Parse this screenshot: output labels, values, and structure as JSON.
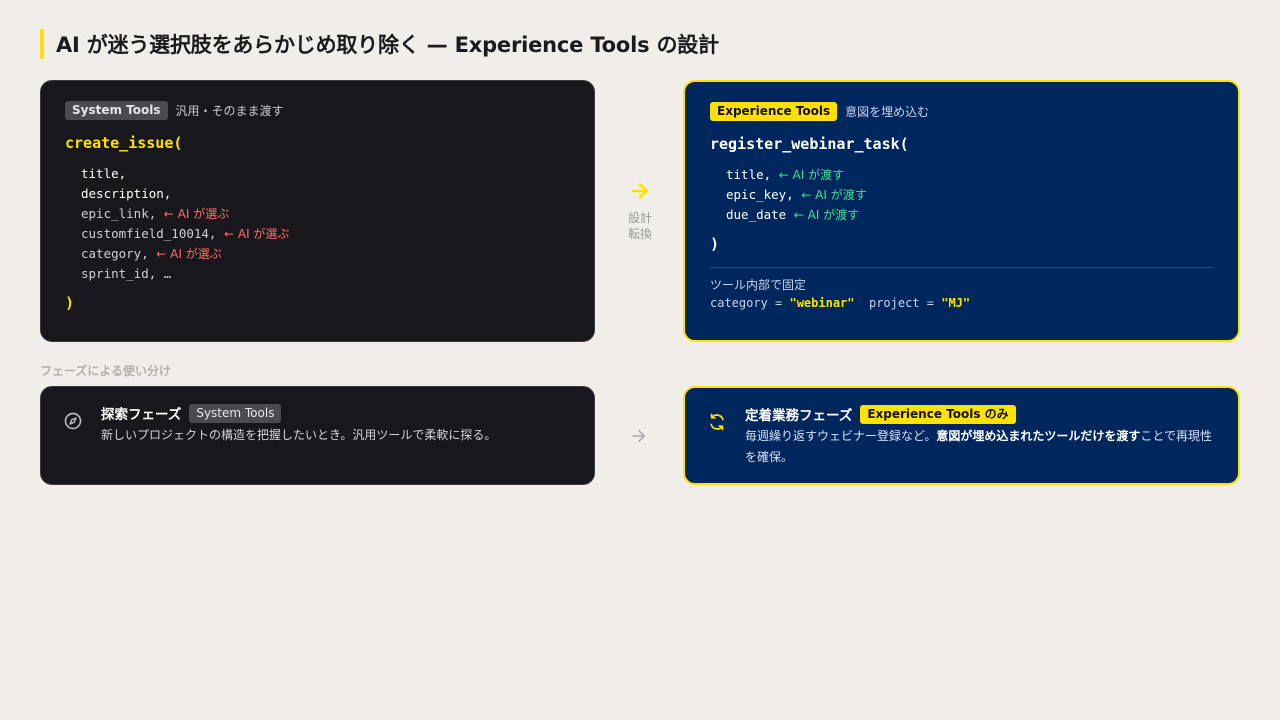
{
  "title": "AI が迷う選択肢をあらかじめ取り除く — Experience Tools の設計",
  "colors": {
    "accent": "#ffe100",
    "navy": "#00265e",
    "dark": "#18181c",
    "red": "#ff6b6b",
    "green": "#3fe08f",
    "yellow_string": "#ffe100"
  },
  "system_card": {
    "badge": "System Tools",
    "subtitle": "汎用・そのまま渡す",
    "function": "create_issue(",
    "close": ")",
    "params": [
      {
        "name": "title,",
        "note": ""
      },
      {
        "name": "description,",
        "note": ""
      },
      {
        "name": "epic_link,",
        "note": "← AI が選ぶ"
      },
      {
        "name": "customfield_10014,",
        "note": "← AI が選ぶ"
      },
      {
        "name": "category,",
        "note": "← AI が選ぶ"
      },
      {
        "name": "sprint_id, …",
        "note": ""
      }
    ]
  },
  "middle": {
    "arrow_icon": "arrow-right-icon",
    "label_line1": "設計",
    "label_line2": "転換"
  },
  "experience_card": {
    "badge": "Experience Tools",
    "subtitle": "意図を埋め込む",
    "function": "register_webinar_task(",
    "close": ")",
    "params": [
      {
        "name": "title,",
        "note": "← AI が渡す"
      },
      {
        "name": "epic_key,",
        "note": "← AI が渡す"
      },
      {
        "name": "due_date",
        "note": "← AI が渡す"
      }
    ],
    "fixed_label": "ツール内部で固定",
    "fixed_1_key": "category = ",
    "fixed_1_val": "\"webinar\"",
    "fixed_2_key": "project = ",
    "fixed_2_val": "\"MJ\""
  },
  "section_label": "フェーズによる使い分け",
  "explore_phase": {
    "icon": "compass-icon",
    "title": "探索フェーズ",
    "badge": "System Tools",
    "desc": "新しいプロジェクトの構造を把握したいとき。汎用ツールで柔軟に探る。"
  },
  "phase_arrow": "arrow-right-icon",
  "settled_phase": {
    "icon": "refresh-icon",
    "title": "定着業務フェーズ",
    "badge": "Experience Tools のみ",
    "desc_1": "毎週繰り返すウェビナー登録など。",
    "desc_bold": "意図が埋め込まれたツールだけを渡す",
    "desc_2": "ことで再現性を確保。"
  }
}
